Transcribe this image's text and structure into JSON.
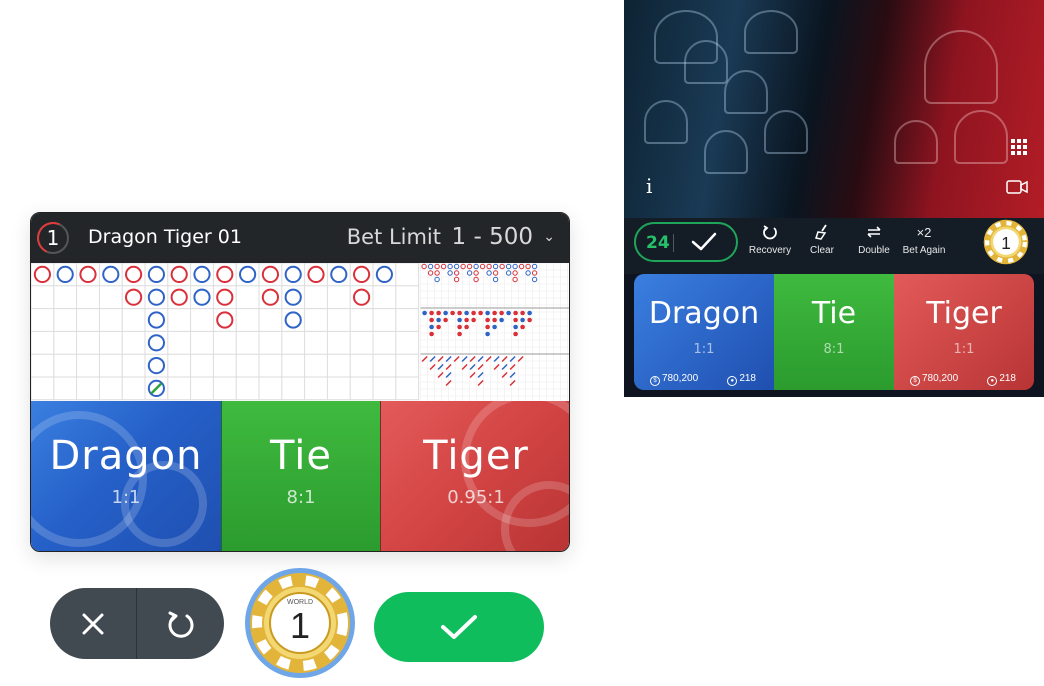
{
  "left_table": {
    "round_number": "1",
    "table_name": "Dragon Tiger 01",
    "bet_limit_label": "Bet Limit",
    "bet_limit_value": "1 - 500",
    "bet_zones": [
      {
        "name": "Dragon",
        "odds": "1:1"
      },
      {
        "name": "Tie",
        "odds": "8:1"
      },
      {
        "name": "Tiger",
        "odds": "0.95:1"
      }
    ],
    "big_road": {
      "legend": {
        "red": "Dragon",
        "blue": "Tiger",
        "green_slash": "Tie"
      },
      "columns": [
        [
          "red"
        ],
        [
          "blue"
        ],
        [
          "red"
        ],
        [
          "blue"
        ],
        [
          "red",
          "red"
        ],
        [
          "blue",
          "blue",
          "blue",
          "blue",
          "blue",
          "blue-tie"
        ],
        [
          "red",
          "red"
        ],
        [
          "blue",
          "blue"
        ],
        [
          "red",
          "red",
          "red"
        ],
        [
          "blue"
        ],
        [
          "red",
          "red"
        ],
        [
          "blue",
          "blue",
          "blue"
        ],
        [
          "red"
        ],
        [
          "blue"
        ],
        [
          "red",
          "red"
        ],
        [
          "blue"
        ]
      ]
    }
  },
  "left_controls": {
    "chip_value": "1",
    "chip_text": "WORLD"
  },
  "right_table": {
    "timer": "24",
    "actions": [
      {
        "label": "Recovery",
        "icon": "recovery-icon"
      },
      {
        "label": "Clear",
        "icon": "broom-icon"
      },
      {
        "label": "Double",
        "icon": "double-icon"
      },
      {
        "label": "Bet Again",
        "icon": "x2-icon",
        "glyph": "×2"
      }
    ],
    "chip_value": "1",
    "info_glyph": "i",
    "zones": [
      {
        "name": "Dragon",
        "odds": "1:1",
        "amount": "780,200",
        "players": "218"
      },
      {
        "name": "Tie",
        "odds": "8:1"
      },
      {
        "name": "Tiger",
        "odds": "1:1",
        "amount": "780,200",
        "players": "218"
      }
    ]
  },
  "colors": {
    "dragon_blue": "#2a66cc",
    "tie_green": "#34a838",
    "tiger_red": "#d24545",
    "confirm_green": "#0fbd5d",
    "header_dark": "#232629"
  }
}
